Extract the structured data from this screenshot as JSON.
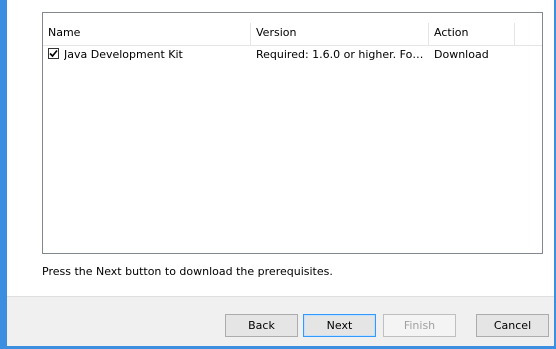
{
  "table": {
    "columns": [
      "Name",
      "Version",
      "Action"
    ],
    "rows": [
      {
        "checked": true,
        "name": "Java Development Kit",
        "version": "Required: 1.6.0 or higher. Foun...",
        "action": "Download"
      }
    ]
  },
  "status_text": "Press the Next button to download the prerequisites.",
  "buttons": {
    "back": "Back",
    "next": "Next",
    "finish": "Finish",
    "cancel": "Cancel"
  },
  "colors": {
    "window_border": "#3c8ee0",
    "default_button_border": "#3399ff",
    "disabled_text": "#a0a0a0"
  }
}
